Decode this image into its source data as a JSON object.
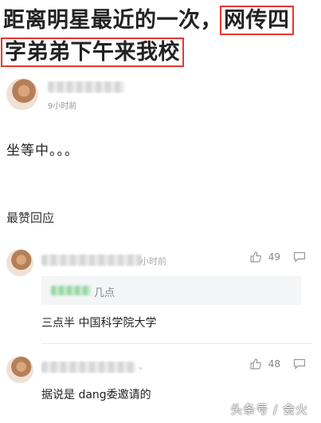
{
  "article": {
    "title_part1": "距离明星最近的一次，",
    "title_part2": "网传四",
    "title_part3": "字弟弟下午来我校",
    "author_time": "9小时前",
    "body": "坐等中。。。"
  },
  "section_title": "最赞回应",
  "comments": [
    {
      "time": "小时前",
      "likes": "49",
      "reply_text": "几点",
      "text": "三点半 中国科学院大学"
    },
    {
      "time": "、",
      "likes": "48",
      "text": "据说是 dang委邀请的"
    }
  ],
  "watermark": "头条号 / 会火",
  "colors": {
    "highlight_box": "#e8372f"
  }
}
